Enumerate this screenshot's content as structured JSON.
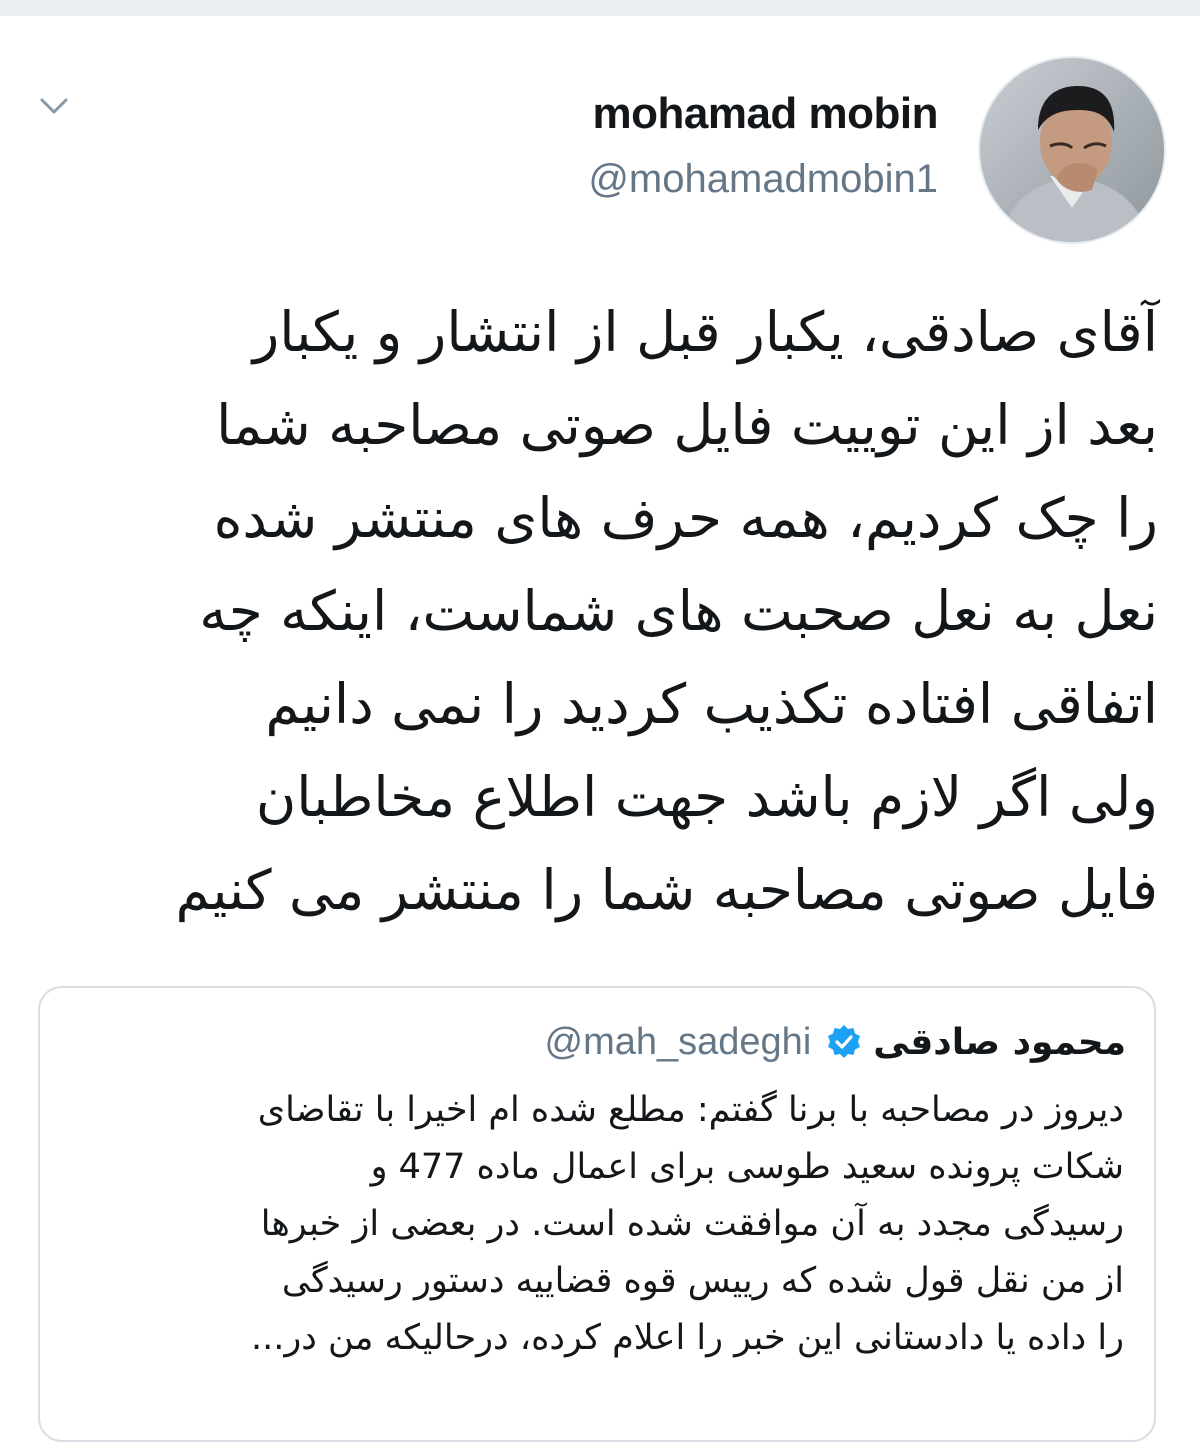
{
  "tweet": {
    "author": {
      "display_name": "mohamad mobin",
      "handle": "@mohamadmobin1",
      "avatar_icon": "person-photo"
    },
    "menu_icon": "chevron-down-icon",
    "lines": [
      "آقای صادقی، یکبار قبل از انتشار و یکبار",
      "بعد از این توییت فایل صوتی مصاحبه شما",
      "را چک کردیم، همه حرف های منتشر شده",
      "نعل به نعل صحبت های شماست، اینکه چه",
      "اتفاقی افتاده تکذیب کردید را نمی دانیم",
      "ولی اگر لازم باشد جهت اطلاع مخاطبان",
      "فایل صوتی مصاحبه شما را منتشر می کنیم"
    ]
  },
  "quoted_tweet": {
    "display_name": "محمود صادقی",
    "verified_icon": "verified-badge-icon",
    "handle": "@mah_sadeghi",
    "lines": [
      "دیروز در مصاحبه با برنا گفتم: مطلع شده ام اخیرا با تقاضای",
      "شکات پرونده سعید طوسی برای اعمال ماده 477 و",
      "رسیدگی مجدد به آن موافقت شده است. در بعضی از خبرها",
      "از من نقل قول شده که رییس قوه قضاییه دستور رسیدگی",
      "را داده یا دادستانی این خبر را اعلام کرده، درحالیکه من در..."
    ]
  },
  "colors": {
    "text": "#14171a",
    "secondary_text": "#657786",
    "verified_blue": "#1da1f2",
    "card_border": "#d8dee3",
    "top_band": "#eceff1"
  }
}
